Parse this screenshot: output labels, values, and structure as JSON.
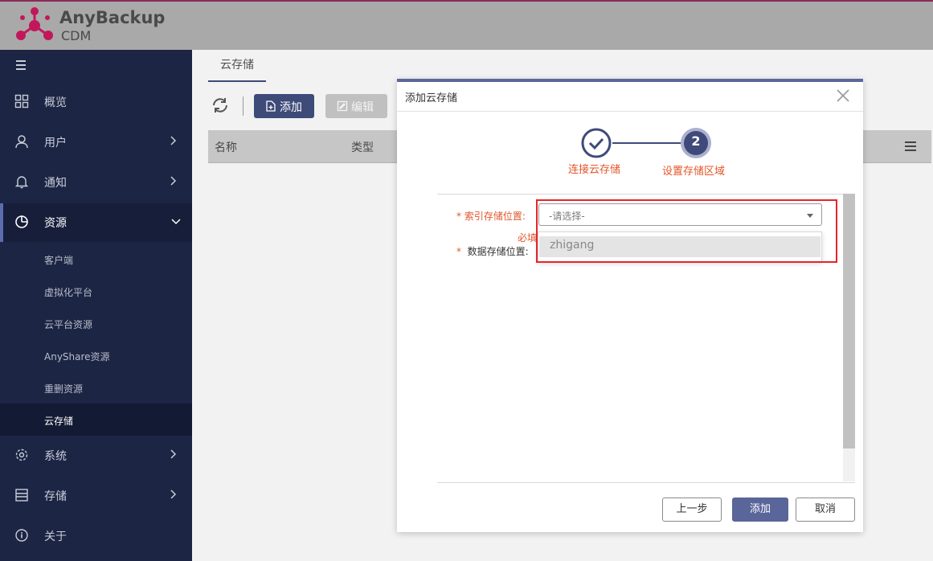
{
  "app": {
    "name_line1": "AnyBackup",
    "name_line2": "CDM"
  },
  "sidebar": {
    "items": [
      {
        "label": "概览",
        "icon": "grid-icon"
      },
      {
        "label": "用户",
        "icon": "user-icon"
      },
      {
        "label": "通知",
        "icon": "bell-icon"
      },
      {
        "label": "资源",
        "icon": "pie-icon",
        "expanded": true
      },
      {
        "label": "系统",
        "icon": "gear-icon"
      },
      {
        "label": "存储",
        "icon": "storage-icon"
      },
      {
        "label": "关于",
        "icon": "info-icon"
      }
    ],
    "sub_items": [
      "客户端",
      "虚拟化平台",
      "云平台资源",
      "AnyShare资源",
      "重删资源",
      "云存储"
    ],
    "selected_sub": "云存储"
  },
  "main": {
    "tab": "云存储",
    "toolbar": {
      "add_label": "添加",
      "edit_label": "编辑"
    },
    "table": {
      "columns": [
        "名称",
        "类型"
      ]
    }
  },
  "dialog": {
    "title": "添加云存储",
    "steps": [
      {
        "number": "1",
        "label": "连接云存储",
        "done": true
      },
      {
        "number": "2",
        "label": "设置存储区域",
        "done": false
      }
    ],
    "fields": {
      "index_label": "* 索引存储位置:",
      "data_label_star": "*",
      "data_label": "数据存储位置:",
      "select_placeholder": "-请选择-",
      "required_msg": "必填"
    },
    "dropdown_options": [
      "zhigang"
    ],
    "buttons": {
      "prev": "上一步",
      "add": "添加",
      "cancel": "取消"
    }
  },
  "colors": {
    "sidebar_bg": "#1c2544",
    "accent": "#3e4a78",
    "error": "#e2572b",
    "highlight_box": "#e8242a"
  }
}
